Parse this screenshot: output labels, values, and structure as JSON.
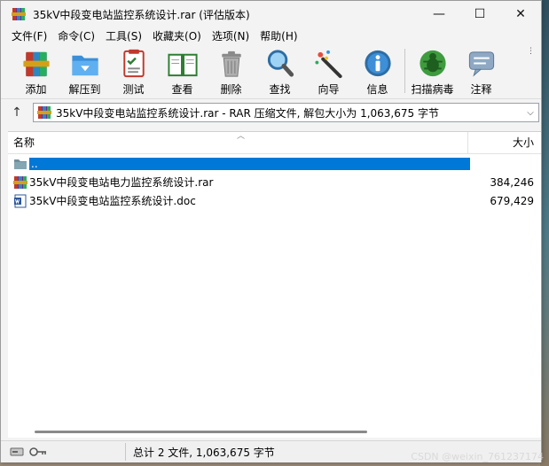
{
  "window": {
    "title": "35kV中段变电站监控系统设计.rar (评估版本)",
    "minimize": "—",
    "maximize": "☐",
    "close": "✕"
  },
  "menu": [
    "文件(F)",
    "命令(C)",
    "工具(S)",
    "收藏夹(O)",
    "选项(N)",
    "帮助(H)"
  ],
  "toolbar": {
    "add": "添加",
    "extract": "解压到",
    "test": "测试",
    "view": "查看",
    "delete": "删除",
    "find": "查找",
    "wizard": "向导",
    "info": "信息",
    "scan": "扫描病毒",
    "comment": "注释"
  },
  "pathbar": {
    "path": "35kV中段变电站监控系统设计.rar - RAR 压缩文件, 解包大小为 1,063,675 字节"
  },
  "columns": {
    "name": "名称",
    "size": "大小"
  },
  "files": [
    {
      "name": "..",
      "size": "",
      "icon": "folder-icon"
    },
    {
      "name": "35kV中段变电站电力监控系统设计.rar",
      "size": "384,246",
      "icon": "rar-icon"
    },
    {
      "name": "35kV中段变电站监控系统设计.doc",
      "size": "679,429",
      "icon": "word-doc-icon"
    }
  ],
  "status": {
    "summary": "总计 2 文件, 1,063,675 字节"
  },
  "watermark": "CSDN @weixin_761237174",
  "colors": {
    "selection": "#0078d7",
    "window_bg": "#f3f3f3"
  }
}
